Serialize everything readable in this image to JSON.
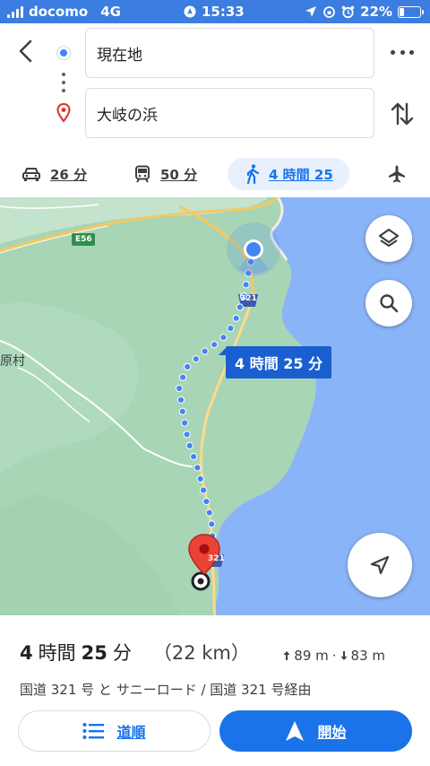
{
  "status_bar": {
    "carrier": "docomo",
    "network": "4G",
    "time": "15:33",
    "battery_percent": "22%",
    "battery_level": 0.22
  },
  "directions": {
    "origin": "現在地",
    "destination": "大岐の浜"
  },
  "modes": [
    {
      "icon": "car-icon",
      "label": "26 分"
    },
    {
      "icon": "train-icon",
      "label": "50 分"
    },
    {
      "icon": "walk-icon",
      "label": "4 時間 25",
      "active": true
    },
    {
      "icon": "flight-icon",
      "label": ""
    }
  ],
  "map": {
    "duration_bubble": "4 時間 25 分",
    "road_e56": "E56",
    "route_321_top": "321",
    "route_321_bottom": "321",
    "place_label": "原村"
  },
  "summary": {
    "hours": "4",
    "hours_unit": "時間",
    "minutes": "25",
    "minutes_unit": "分",
    "distance": "（22 km）",
    "ascent": "89 m",
    "separator": "·",
    "descent": "83 m",
    "via": "国道 321 号 と サニーロード / 国道 321 号経由"
  },
  "buttons": {
    "steps": "道順",
    "start": "開始"
  },
  "colors": {
    "accent": "#1a73e8",
    "route": "#4285f4",
    "water": "#8ab4f8",
    "land": "#a8d5b5",
    "pin": "#ea4335"
  }
}
